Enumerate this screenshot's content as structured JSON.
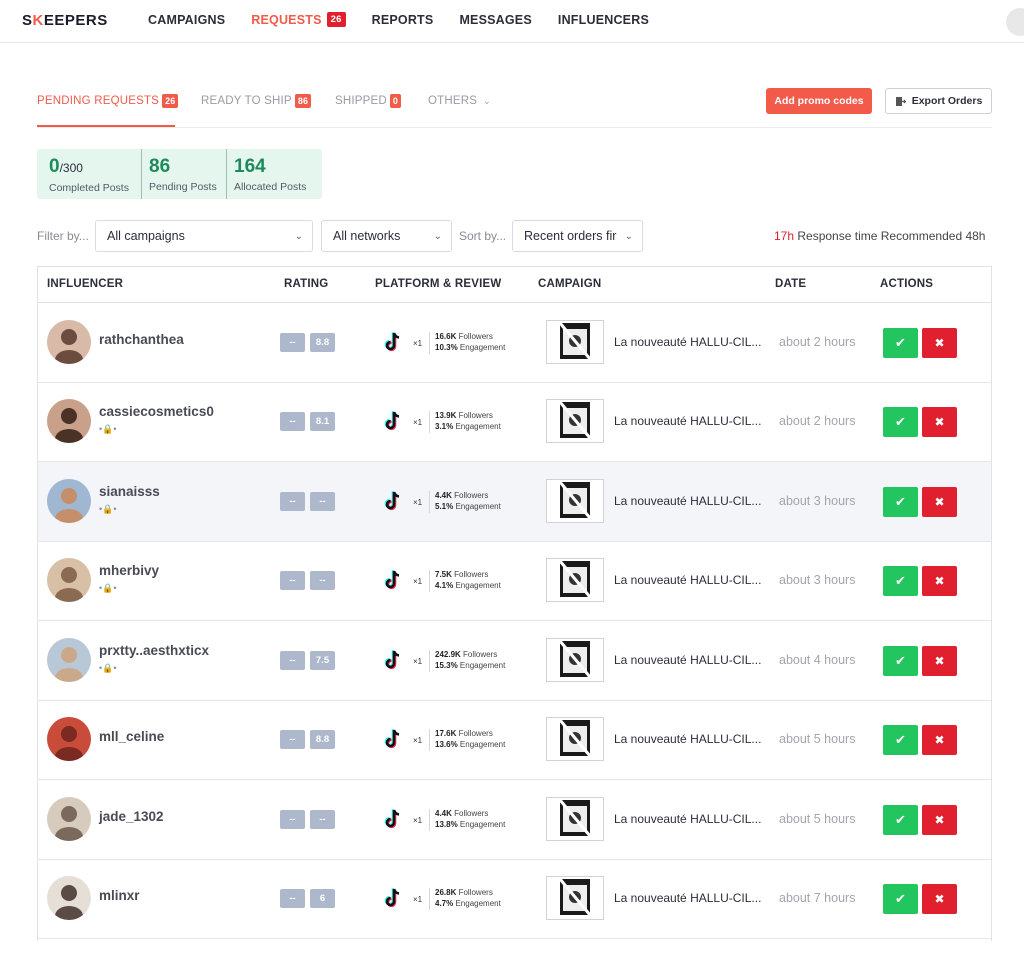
{
  "nav": {
    "logo_start": "S",
    "logo_k": "K",
    "logo_end": "EEPERS",
    "links": [
      {
        "label": "CAMPAIGNS"
      },
      {
        "label": "REQUESTS",
        "badge": "26"
      },
      {
        "label": "REPORTS"
      },
      {
        "label": "MESSAGES"
      },
      {
        "label": "INFLUENCERS"
      }
    ]
  },
  "tabs": [
    {
      "label": "PENDING REQUESTS",
      "badge": "26"
    },
    {
      "label": "READY TO SHIP",
      "badge": "86"
    },
    {
      "label": "SHIPPED",
      "badge": "0"
    },
    {
      "label": "OTHERS"
    }
  ],
  "buttons": {
    "promo": "Add promo codes",
    "export": "Export Orders"
  },
  "stats": [
    {
      "value": "0",
      "denominator": "/300",
      "label": "Completed Posts"
    },
    {
      "value": "86",
      "label": "Pending Posts"
    },
    {
      "value": "164",
      "label": "Allocated Posts"
    }
  ],
  "filters": {
    "filter_label": "Filter by...",
    "campaigns": "All campaigns",
    "networks": "All networks",
    "sort_label": "Sort by...",
    "sort": "Recent orders fir"
  },
  "response": {
    "value": "17h",
    "text": " Response time Recommended 48h"
  },
  "columns": [
    "INFLUENCER",
    "RATING",
    "PLATFORM & REVIEW",
    "CAMPAIGN",
    "DATE",
    "ACTIONS"
  ],
  "colors": {
    "accent": "#f25a4a",
    "approve": "#22c55e",
    "reject": "#e0202e",
    "stats_bg": "#e4f6ee"
  },
  "rows": [
    {
      "name": "rathchanthea",
      "sub": "",
      "r1": "--",
      "r2": "8.8",
      "x": "×1",
      "followers": "16.6K",
      "engagement": "10.3%",
      "followers_label": "Followers",
      "engagement_label": "Engagement",
      "campaign": "La nouveauté HALLU-CIL...",
      "date": "about 2 hours"
    },
    {
      "name": "cassiecosmetics0",
      "sub": "•🔒•",
      "r1": "--",
      "r2": "8.1",
      "x": "×1",
      "followers": "13.9K",
      "engagement": "3.1%",
      "followers_label": "Followers",
      "engagement_label": "Engagement",
      "campaign": "La nouveauté HALLU-CIL...",
      "date": "about 2 hours"
    },
    {
      "name": "sianaisss",
      "sub": "•🔒•",
      "r1": "--",
      "r2": "--",
      "x": "×1",
      "followers": "4.4K",
      "engagement": "5.1%",
      "followers_label": "Followers",
      "engagement_label": "Engagement",
      "campaign": "La nouveauté HALLU-CIL...",
      "date": "about 3 hours"
    },
    {
      "name": "mherbivy",
      "sub": "•🔒•",
      "r1": "--",
      "r2": "--",
      "x": "×1",
      "followers": "7.5K",
      "engagement": "4.1%",
      "followers_label": "Followers",
      "engagement_label": "Engagement",
      "campaign": "La nouveauté HALLU-CIL...",
      "date": "about 3 hours"
    },
    {
      "name": "prxtty..aesthxticx",
      "sub": "•🔒•",
      "r1": "--",
      "r2": "7.5",
      "x": "×1",
      "followers": "242.9K",
      "engagement": "15.3%",
      "followers_label": "Followers",
      "engagement_label": "Engagement",
      "campaign": "La nouveauté HALLU-CIL...",
      "date": "about 4 hours"
    },
    {
      "name": "mll_celine",
      "sub": "",
      "r1": "--",
      "r2": "8.8",
      "x": "×1",
      "followers": "17.6K",
      "engagement": "13.6%",
      "followers_label": "Followers",
      "engagement_label": "Engagement",
      "campaign": "La nouveauté HALLU-CIL...",
      "date": "about 5 hours"
    },
    {
      "name": "jade_1302",
      "sub": "",
      "r1": "--",
      "r2": "--",
      "x": "×1",
      "followers": "4.4K",
      "engagement": "13.8%",
      "followers_label": "Followers",
      "engagement_label": "Engagement",
      "campaign": "La nouveauté HALLU-CIL...",
      "date": "about 5 hours"
    },
    {
      "name": "mlinxr",
      "sub": "",
      "r1": "--",
      "r2": "6",
      "x": "×1",
      "followers": "26.8K",
      "engagement": "4.7%",
      "followers_label": "Followers",
      "engagement_label": "Engagement",
      "campaign": "La nouveauté HALLU-CIL...",
      "date": "about 7 hours"
    }
  ]
}
